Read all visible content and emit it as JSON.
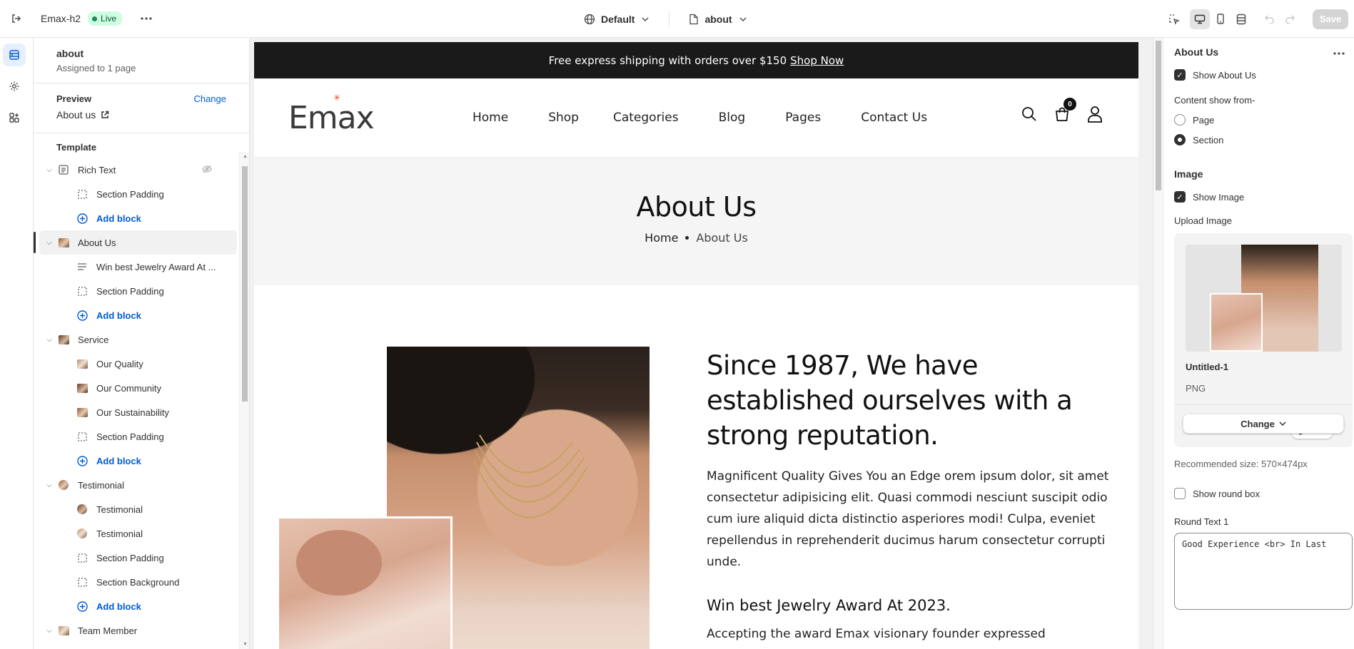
{
  "topbar": {
    "store_name": "Emax-h2",
    "live_badge": "Live",
    "theme_select": "Default",
    "page_select": "about",
    "save_label": "Save"
  },
  "left_panel": {
    "template_name": "about",
    "assigned": "Assigned to 1 page",
    "preview_label": "Preview",
    "preview_change": "Change",
    "preview_page": "About us",
    "tree_label": "Template",
    "sections": [
      {
        "label": "Rich Text",
        "blocks": [
          "Section Padding"
        ],
        "add": "Add block"
      },
      {
        "label": "About Us",
        "blocks": [
          "Win best Jewelry Award At ...",
          "Section Padding"
        ],
        "add": "Add block"
      },
      {
        "label": "Service",
        "blocks": [
          "Our Quality",
          "Our Community",
          "Our Sustainability",
          "Section Padding"
        ],
        "add": "Add block"
      },
      {
        "label": "Testimonial",
        "blocks": [
          "Testimonial",
          "Testimonial",
          "Section Padding",
          "Section Background"
        ],
        "add": "Add block"
      },
      {
        "label": "Team Member"
      }
    ]
  },
  "site": {
    "announcement": "Free express shipping with orders over $150",
    "announcement_link": "Shop Now",
    "logo": "Emax",
    "nav": [
      "Home",
      "Shop",
      "Categories",
      "Blog",
      "Pages",
      "Contact Us"
    ],
    "cart_count": "0",
    "banner_title": "About Us",
    "breadcrumb_home": "Home",
    "breadcrumb_current": "About Us",
    "heading": "Since 1987, We have established ourselves with a strong reputation.",
    "paragraph": "Magnificent Quality Gives You an Edge orem ipsum dolor, sit amet consectetur adipisicing elit. Quasi commodi nesciunt suscipit odio cum iure aliquid dicta distinctio asperiores modi! Culpa, eveniet repellendus in reprehenderit ducimus harum consectetur corrupti unde.",
    "subheading": "Win best Jewelry Award At 2023.",
    "paragraph2": "Accepting the award Emax visionary founder expressed"
  },
  "right_panel": {
    "title": "About Us",
    "show_about": "Show About Us",
    "content_from_label": "Content show from-",
    "option_page": "Page",
    "option_section": "Section",
    "image_group": "Image",
    "show_image": "Show Image",
    "upload_label": "Upload Image",
    "edit_label": "Edit",
    "file_name": "Untitled-1",
    "file_type": "PNG",
    "change_label": "Change",
    "recommended": "Recommended size: 570×474px",
    "show_round_box": "Show round box",
    "round_text_label": "Round Text 1",
    "round_text_value": "Good Experience <br> In Last"
  },
  "colors": {
    "accent": "#005bd3",
    "live_bg": "#cdfee1",
    "announce_bg": "#1a1a1a"
  }
}
